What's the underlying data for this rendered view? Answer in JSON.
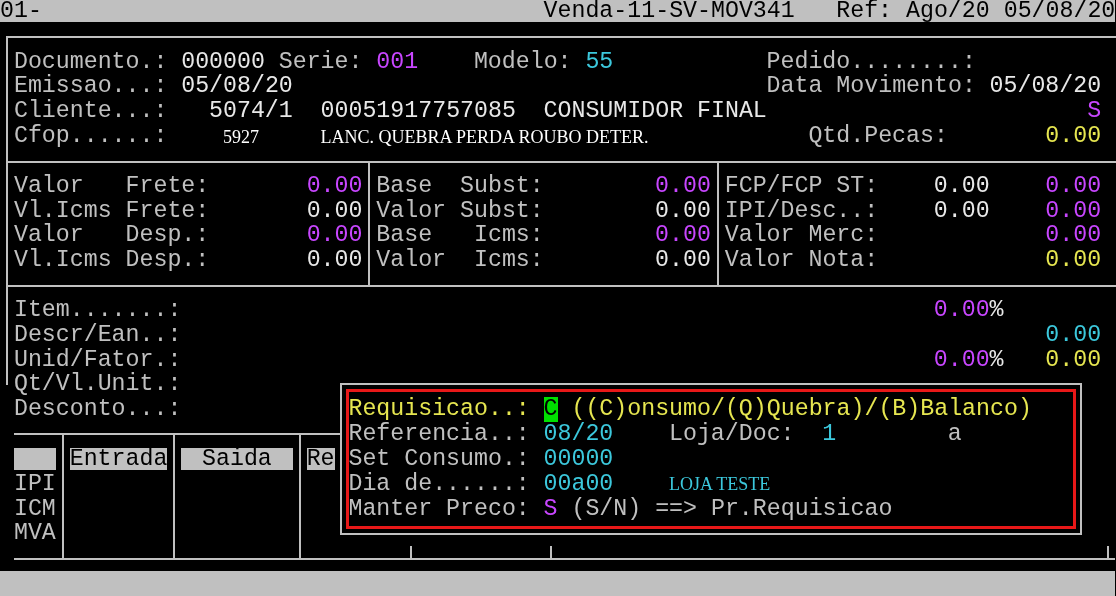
{
  "title_bar": [
    {
      "text": "01-"
    },
    {
      "text": "Venda-11-SV-MOV341"
    },
    {
      "text": "Ref: Ago/20 05/08/20"
    }
  ],
  "header": [
    [
      {
        "kind": "label",
        "text": "Documento.:"
      },
      {
        "kind": "value",
        "text": "000000",
        "color": "#e8e8e8"
      },
      {
        "kind": "label",
        "text": "Serie:"
      },
      {
        "kind": "value",
        "text": "001",
        "color": "#c846ff"
      },
      {
        "kind": "label",
        "text": "Modelo:"
      },
      {
        "kind": "value",
        "text": "55",
        "color": "#3cc8dc"
      },
      {
        "kind": "label",
        "text": "Pedido........:"
      }
    ],
    [
      {
        "kind": "label",
        "text": "Emissao...:"
      },
      {
        "kind": "value",
        "text": "05/08/20",
        "color": "#e8e8e8"
      },
      {
        "kind": "label",
        "text": "Data Movimento:"
      },
      {
        "kind": "value",
        "text": "05/08/20",
        "color": "#e8e8e8"
      }
    ],
    [
      {
        "kind": "label",
        "text": "Cliente...:"
      },
      {
        "kind": "value",
        "text": "5074/1",
        "color": "#e8e8e8"
      },
      {
        "kind": "value",
        "text": "00051917757085",
        "color": "#e8e8e8"
      },
      {
        "kind": "value",
        "text": "CONSUMIDOR FINAL",
        "color": "#e8e8e8"
      },
      {
        "kind": "value",
        "text": "S",
        "color": "#c846ff"
      }
    ],
    [
      {
        "kind": "label",
        "text": "Cfop......:"
      },
      {
        "kind": "text",
        "text": "5927",
        "color": "#ffffff"
      },
      {
        "kind": "text",
        "text": "LANC. QUEBRA PERDA ROUBO DETER.",
        "color": "#ffffff"
      },
      {
        "kind": "label",
        "text": "Qtd.Pecas:"
      },
      {
        "kind": "value",
        "text": "0.00",
        "color": "#e6e650"
      }
    ]
  ],
  "totals": [
    [
      {
        "kind": "label",
        "text": "Valor   Frete:"
      },
      {
        "kind": "value",
        "text": "0.00",
        "color": "#c846ff"
      },
      {
        "kind": "label",
        "text": "Base  Subst:"
      },
      {
        "kind": "value",
        "text": "0.00",
        "color": "#c846ff"
      },
      {
        "kind": "label",
        "text": "FCP/FCP ST:"
      },
      {
        "kind": "value",
        "text": "0.00",
        "color": "#e8e8e8"
      },
      {
        "kind": "value",
        "text": "0.00",
        "color": "#c846ff"
      }
    ],
    [
      {
        "kind": "label",
        "text": "Vl.Icms Frete:"
      },
      {
        "kind": "value",
        "text": "0.00",
        "color": "#e8e8e8"
      },
      {
        "kind": "label",
        "text": "Valor Subst:"
      },
      {
        "kind": "value",
        "text": "0.00",
        "color": "#e8e8e8"
      },
      {
        "kind": "label",
        "text": "IPI/Desc..:"
      },
      {
        "kind": "value",
        "text": "0.00",
        "color": "#e8e8e8"
      },
      {
        "kind": "value",
        "text": "0.00",
        "color": "#c846ff"
      }
    ],
    [
      {
        "kind": "label",
        "text": "Valor   Desp.:"
      },
      {
        "kind": "value",
        "text": "0.00",
        "color": "#c846ff"
      },
      {
        "kind": "label",
        "text": "Base   Icms:"
      },
      {
        "kind": "value",
        "text": "0.00",
        "color": "#c846ff"
      },
      {
        "kind": "label",
        "text": "Valor Merc:"
      },
      {
        "kind": "value",
        "text": "0.00",
        "color": "#c846ff"
      }
    ],
    [
      {
        "kind": "label",
        "text": "Vl.Icms Desp.:"
      },
      {
        "kind": "value",
        "text": "0.00",
        "color": "#e8e8e8"
      },
      {
        "kind": "label",
        "text": "Valor  Icms:"
      },
      {
        "kind": "value",
        "text": "0.00",
        "color": "#e8e8e8"
      },
      {
        "kind": "label",
        "text": "Valor Nota:"
      },
      {
        "kind": "value",
        "text": "0.00",
        "color": "#e6e650"
      }
    ]
  ],
  "items": [
    [
      {
        "kind": "label",
        "text": "Item.......:"
      },
      {
        "kind": "value",
        "text": "0.00",
        "color": "#c846ff"
      },
      {
        "kind": "value",
        "text": "%",
        "color": "#e8e8e8"
      }
    ],
    [
      {
        "kind": "label",
        "text": "Descr/Ean..:"
      },
      {
        "kind": "value",
        "text": "0.00",
        "color": "#3cc8dc"
      }
    ],
    [
      {
        "kind": "label",
        "text": "Unid/Fator.:"
      },
      {
        "kind": "value",
        "text": "0.00",
        "color": "#c846ff"
      },
      {
        "kind": "value",
        "text": "%",
        "color": "#e8e8e8"
      },
      {
        "kind": "value",
        "text": "0.00",
        "color": "#e6e650"
      }
    ],
    [
      {
        "kind": "label",
        "text": "Qt/Vl.Unit.:"
      }
    ],
    [
      {
        "kind": "label",
        "text": "Desconto...:"
      }
    ]
  ],
  "table": {
    "columns": [
      "Entrada",
      "Saida",
      "Re"
    ],
    "row_labels": [
      "IPI",
      "ICM",
      "MVA"
    ]
  },
  "dialog": [
    [
      {
        "kind": "label",
        "text": "Requisicao..:",
        "color": "#e6e650"
      },
      {
        "kind": "cursor",
        "text": "C",
        "color": "#00e000"
      },
      {
        "kind": "label",
        "text": "((C)onsumo/(Q)Quebra)/(B)Balanco)",
        "color": "#e6e650"
      }
    ],
    [
      {
        "kind": "label",
        "text": "Referencia..:"
      },
      {
        "kind": "value",
        "text": "08/20",
        "color": "#3cc8dc"
      },
      {
        "kind": "label",
        "text": "Loja/Doc:"
      },
      {
        "kind": "value",
        "text": "1",
        "color": "#3cc8dc"
      },
      {
        "kind": "value",
        "text": "a",
        "color": "#c0c0c0"
      }
    ],
    [
      {
        "kind": "label",
        "text": "Set Consumo.:"
      },
      {
        "kind": "value",
        "text": "00000",
        "color": "#3cc8dc"
      }
    ],
    [
      {
        "kind": "label",
        "text": "Dia de......:"
      },
      {
        "kind": "value",
        "text": "00a00",
        "color": "#3cc8dc"
      },
      {
        "kind": "text",
        "text": "LOJA TESTE",
        "color": "#3cc8dc"
      }
    ],
    [
      {
        "kind": "label",
        "text": "Manter Preco:"
      },
      {
        "kind": "value",
        "text": "S",
        "color": "#c846ff"
      },
      {
        "kind": "label",
        "text": "(S/N) ==> Pr.Requisicao"
      }
    ]
  ]
}
